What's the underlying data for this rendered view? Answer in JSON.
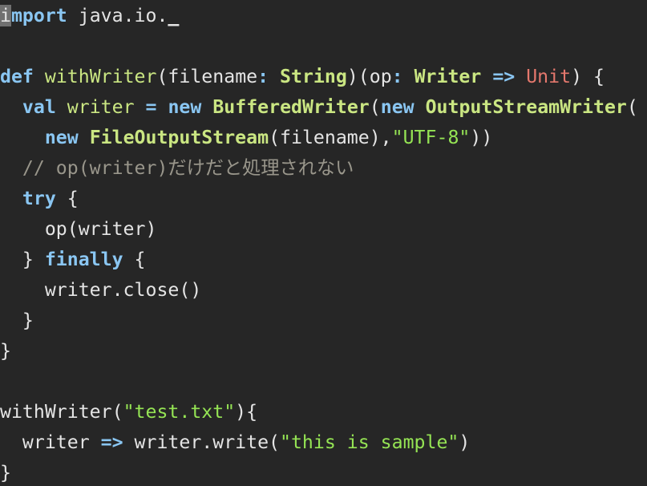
{
  "editor": {
    "colors": {
      "background": "#262626",
      "text": "#e4e4e4",
      "keyword": "#8ac6f2",
      "type": "#cae682",
      "string": "#95e454",
      "unit": "#e5786d",
      "comment": "#99968b",
      "cursor": "#707070"
    },
    "lines": [
      [
        {
          "t": "i",
          "c": "cursor"
        },
        {
          "t": "mport",
          "c": "kw"
        },
        {
          "t": " java.io."
        },
        {
          "t": "_",
          "c": "uline"
        }
      ],
      [],
      [
        {
          "t": "def",
          "c": "kw"
        },
        {
          "t": " "
        },
        {
          "t": "withWriter",
          "c": "fn"
        },
        {
          "t": "(filename"
        },
        {
          "t": ":",
          "c": "op"
        },
        {
          "t": " "
        },
        {
          "t": "String",
          "c": "ty"
        },
        {
          "t": ")(op"
        },
        {
          "t": ":",
          "c": "op"
        },
        {
          "t": " "
        },
        {
          "t": "Writer",
          "c": "ty"
        },
        {
          "t": " "
        },
        {
          "t": "=>",
          "c": "op"
        },
        {
          "t": " "
        },
        {
          "t": "Unit",
          "c": "unit"
        },
        {
          "t": ") {"
        }
      ],
      [
        {
          "t": "  "
        },
        {
          "t": "val",
          "c": "kw"
        },
        {
          "t": " "
        },
        {
          "t": "writer",
          "c": "fn"
        },
        {
          "t": " "
        },
        {
          "t": "=",
          "c": "op"
        },
        {
          "t": " "
        },
        {
          "t": "new",
          "c": "kw"
        },
        {
          "t": " "
        },
        {
          "t": "BufferedWriter",
          "c": "ty"
        },
        {
          "t": "("
        },
        {
          "t": "new",
          "c": "kw"
        },
        {
          "t": " "
        },
        {
          "t": "OutputStreamWriter",
          "c": "ty"
        },
        {
          "t": "("
        }
      ],
      [
        {
          "t": "    "
        },
        {
          "t": "new",
          "c": "kw"
        },
        {
          "t": " "
        },
        {
          "t": "FileOutputStream",
          "c": "ty"
        },
        {
          "t": "(filename),"
        },
        {
          "t": "\"UTF-8\"",
          "c": "str"
        },
        {
          "t": "))"
        }
      ],
      [
        {
          "t": "  "
        },
        {
          "t": "// op(writer)だけだと処理されない",
          "c": "cm"
        }
      ],
      [
        {
          "t": "  "
        },
        {
          "t": "try",
          "c": "kw"
        },
        {
          "t": " {"
        }
      ],
      [
        {
          "t": "    op(writer)"
        }
      ],
      [
        {
          "t": "  } "
        },
        {
          "t": "finally",
          "c": "kw"
        },
        {
          "t": " {"
        }
      ],
      [
        {
          "t": "    writer.close()"
        }
      ],
      [
        {
          "t": "  }"
        }
      ],
      [
        {
          "t": "}"
        }
      ],
      [],
      [
        {
          "t": "withWriter("
        },
        {
          "t": "\"test.txt\"",
          "c": "str"
        },
        {
          "t": "){"
        }
      ],
      [
        {
          "t": "  writer "
        },
        {
          "t": "=>",
          "c": "op"
        },
        {
          "t": " writer.write("
        },
        {
          "t": "\"this is sample\"",
          "c": "str"
        },
        {
          "t": ")"
        }
      ],
      [
        {
          "t": "}"
        }
      ]
    ]
  }
}
